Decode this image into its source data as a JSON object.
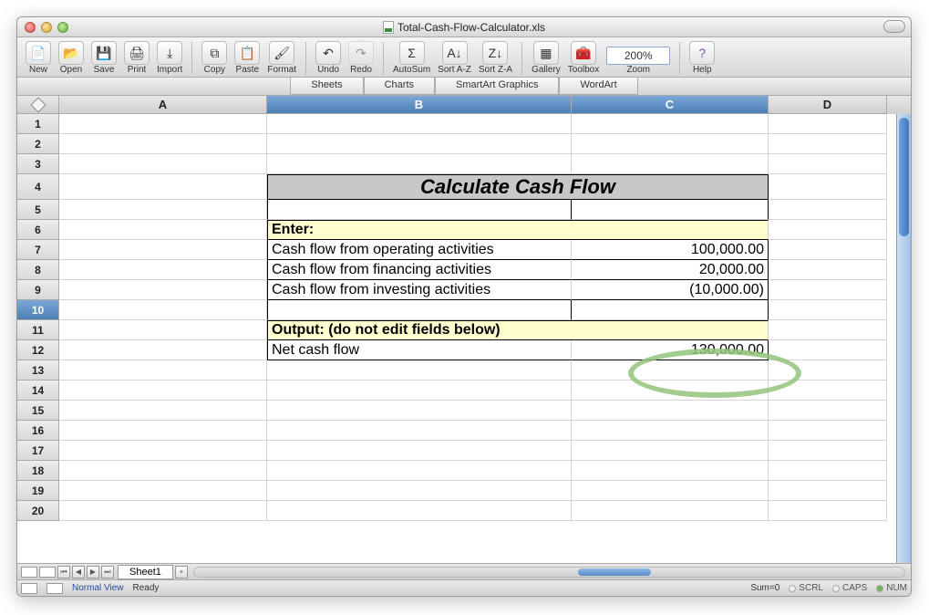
{
  "window": {
    "title": "Total-Cash-Flow-Calculator.xls"
  },
  "toolbar": {
    "new": "New",
    "open": "Open",
    "save": "Save",
    "print": "Print",
    "import": "Import",
    "copy": "Copy",
    "paste": "Paste",
    "format": "Format",
    "undo": "Undo",
    "redo": "Redo",
    "autosum": "AutoSum",
    "sortaz": "Sort A-Z",
    "sortza": "Sort Z-A",
    "gallery": "Gallery",
    "toolbox": "Toolbox",
    "zoom": "Zoom",
    "help": "Help",
    "zoom_value": "200%"
  },
  "subtabs": {
    "sheets": "Sheets",
    "charts": "Charts",
    "smartart": "SmartArt Graphics",
    "wordart": "WordArt"
  },
  "columns": {
    "A": "A",
    "B": "B",
    "C": "C",
    "D": "D"
  },
  "rownums": [
    "1",
    "2",
    "3",
    "4",
    "5",
    "6",
    "7",
    "8",
    "9",
    "10",
    "11",
    "12",
    "13",
    "14",
    "15",
    "16",
    "17",
    "18",
    "19",
    "20"
  ],
  "sheet": {
    "title": "Calculate Cash Flow",
    "enter_label": "Enter:",
    "row7_label": "Cash flow from operating activities",
    "row7_value": "100,000.00",
    "row8_label": "Cash flow from financing activities",
    "row8_value": "20,000.00",
    "row9_label": "Cash flow from investing activities",
    "row9_value": "(10,000.00)",
    "output_label": "Output: (do not edit fields below)",
    "row12_label": "Net cash flow",
    "row12_value": "130,000.00"
  },
  "footer": {
    "sheet1": "Sheet1",
    "plus": "+"
  },
  "status": {
    "view": "Normal View",
    "ready": "Ready",
    "sum": "Sum=0",
    "scrl": "SCRL",
    "caps": "CAPS",
    "num": "NUM"
  }
}
